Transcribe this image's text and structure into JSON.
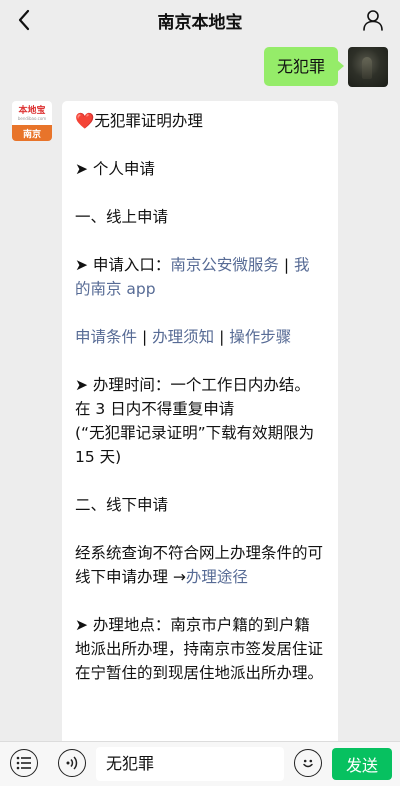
{
  "header": {
    "title": "南京本地宝",
    "back_icon": "chevron-left-icon",
    "profile_icon": "person-icon"
  },
  "messages": {
    "outgoing": {
      "text": "无犯罪"
    },
    "incoming": {
      "avatar": {
        "brand": "本地宝",
        "url": "bendibao.com",
        "city": "南京"
      },
      "heart": "❤️",
      "title": "无犯罪证明办理",
      "personal": "➤ 个人申请",
      "online_heading": "一、线上申请",
      "entry_prefix": "➤ 申请入口：",
      "entry_link1": "南京公安微服务",
      "entry_sep": "|",
      "entry_link2": "我的南京 app",
      "cond_link": "申请条件",
      "sep1": "|",
      "notice_link": "办理须知",
      "sep2": "|",
      "steps_link": "操作步骤",
      "time_line": "➤ 办理时间：一个工作日内办结。在 3 日内不得重复申请",
      "validity_line": "(“无犯罪记录证明”下载有效期限为 15 天)",
      "offline_heading": "二、线下申请",
      "offline_text": "经系统查询不符合网上办理条件的可线下申请办理 →",
      "offline_link": "办理途径",
      "place_line": "➤ 办理地点：南京市户籍的到户籍地派出所办理，持南京市签发居住证在宁暂住的到现居住地派出所办理。"
    }
  },
  "input_bar": {
    "menu_icon": "menu-list-icon",
    "voice_icon": "voice-icon",
    "input_value": "无犯罪",
    "emoji_icon": "emoji-icon",
    "send_label": "发送"
  },
  "colors": {
    "background": "#ededed",
    "bubble_out": "#95ec69",
    "link": "#576b95",
    "send_button": "#07c160",
    "logo_orange": "#e8742a"
  }
}
